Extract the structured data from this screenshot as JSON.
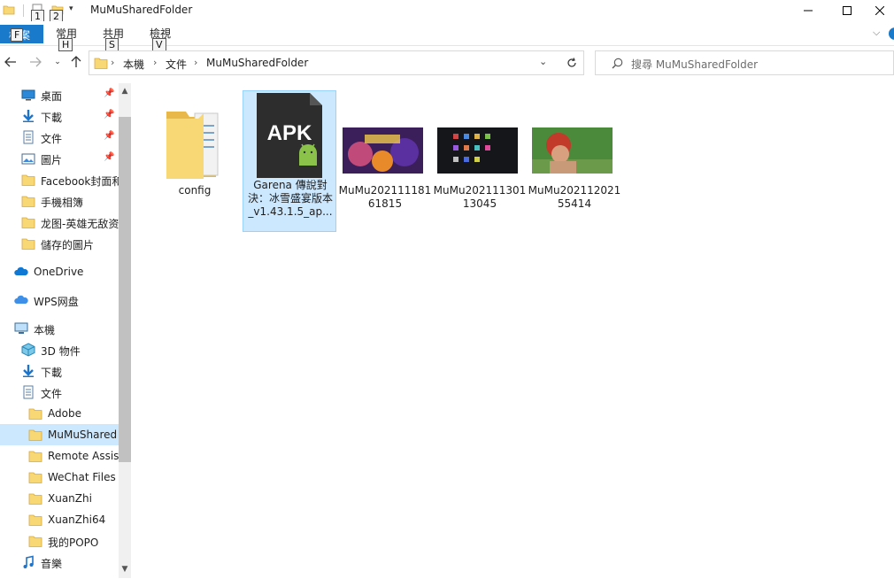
{
  "window": {
    "title": "MuMuSharedFolder",
    "keytips": [
      "1",
      "2",
      "F",
      "H",
      "S",
      "V"
    ]
  },
  "ribbon": {
    "file_tab": "檔案",
    "tabs": [
      {
        "label": "常用",
        "keytip": "H"
      },
      {
        "label": "共用",
        "keytip": "S"
      },
      {
        "label": "檢視",
        "keytip": "V"
      }
    ]
  },
  "address": {
    "breadcrumbs": [
      "本機",
      "文件",
      "MuMuSharedFolder"
    ]
  },
  "search": {
    "placeholder": "搜尋 MuMuSharedFolder"
  },
  "nav": {
    "quick_access": [
      {
        "label": "桌面",
        "icon": "desktop-icon",
        "pinned": true
      },
      {
        "label": "下載",
        "icon": "download-icon",
        "pinned": true
      },
      {
        "label": "文件",
        "icon": "document-icon",
        "pinned": true
      },
      {
        "label": "圖片",
        "icon": "pictures-icon",
        "pinned": true
      },
      {
        "label": "Facebook封面和",
        "icon": "folder-icon"
      },
      {
        "label": "手機相簿",
        "icon": "folder-icon"
      },
      {
        "label": "龙图-英雄无敌资",
        "icon": "folder-icon"
      },
      {
        "label": "儲存的圖片",
        "icon": "folder-icon"
      }
    ],
    "onedrive": "OneDrive",
    "wps": "WPS网盘",
    "this_pc": "本機",
    "pc_items": [
      {
        "label": "3D 物件",
        "icon": "3d-objects-icon"
      },
      {
        "label": "下載",
        "icon": "download-icon"
      },
      {
        "label": "文件",
        "icon": "document-icon"
      }
    ],
    "doc_subfolders": [
      {
        "label": "Adobe"
      },
      {
        "label": "MuMuShared",
        "selected": true
      },
      {
        "label": "Remote Assist"
      },
      {
        "label": "WeChat Files"
      },
      {
        "label": "XuanZhi"
      },
      {
        "label": "XuanZhi64"
      },
      {
        "label": "我的POPO"
      }
    ],
    "music": "音樂"
  },
  "files": [
    {
      "name": "config",
      "type": "folder"
    },
    {
      "name": "Garena 傳說對決：冰雪盛宴版本_v1.43.1.5_ap...",
      "type": "apk",
      "badge": "APK",
      "selected": true
    },
    {
      "name": "MuMu20211118161815",
      "type": "image"
    },
    {
      "name": "MuMu20211130113045",
      "type": "image"
    },
    {
      "name": "MuMu20211202155414",
      "type": "image"
    }
  ]
}
